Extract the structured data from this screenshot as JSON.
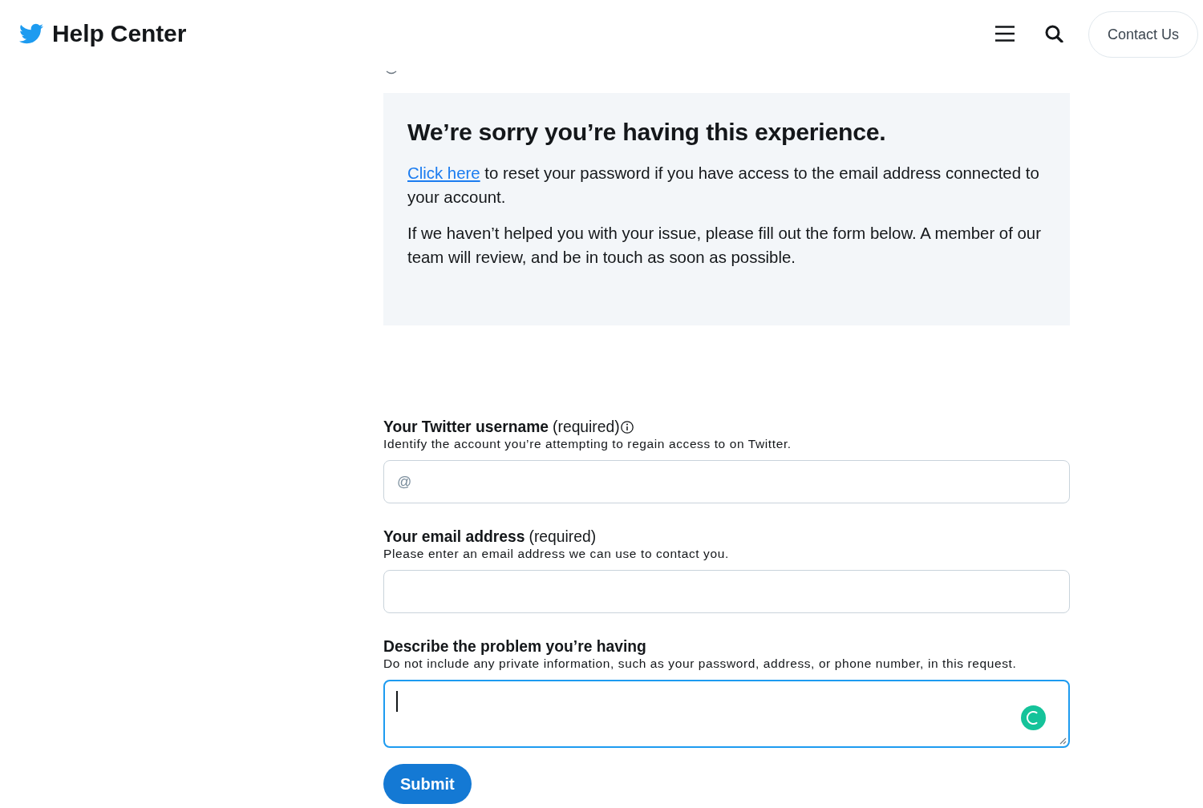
{
  "header": {
    "title": "Help Center",
    "contact_button": "Contact Us"
  },
  "notice": {
    "heading": "We’re sorry you’re having this experience.",
    "paragraphs": [
      {
        "link": "Click here",
        "text": "to reset your password if you have access to the email address connected to your account."
      },
      {
        "text": "If we haven’t helped you with your issue, please fill out the form below. A member of our team will review, and be in touch as soon as possible."
      }
    ]
  },
  "form": {
    "fields": [
      {
        "kind": "input",
        "label": "Your Twitter username",
        "note": "(required)",
        "info": true,
        "description": "Identify the account you’re attempting to regain access to on Twitter.",
        "placeholder": "@",
        "focused": false
      },
      {
        "kind": "input",
        "label": "Your email address",
        "note": "(required)",
        "info": false,
        "description": "Please enter an email address we can use to contact you.",
        "focused": false
      },
      {
        "kind": "textarea",
        "label": "Describe the problem you’re having",
        "info": false,
        "description": "Do not include any private information, such as your password, address, or phone number, in this request.",
        "focused": true
      }
    ],
    "submit": "Submit"
  }
}
